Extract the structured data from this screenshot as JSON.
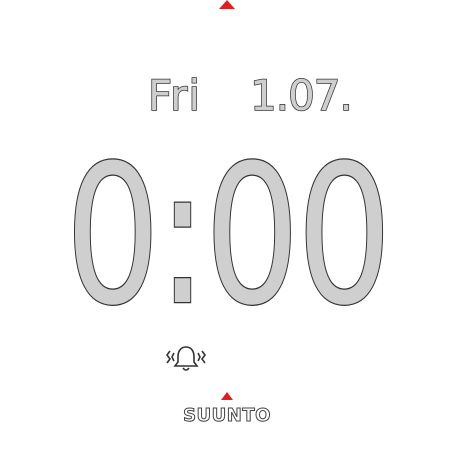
{
  "watch": {
    "day": "Fri",
    "date": "1.07.",
    "time": "0:00",
    "brand": "SUUNTO",
    "alarm_icon": "alarm-bell-icon",
    "indicator_icon": "triangle-up-icon",
    "colors": {
      "background": "#ffffff",
      "digit_fill": "#cfcfcf",
      "digit_outline": "#333333",
      "indicator": "#e02020"
    }
  }
}
